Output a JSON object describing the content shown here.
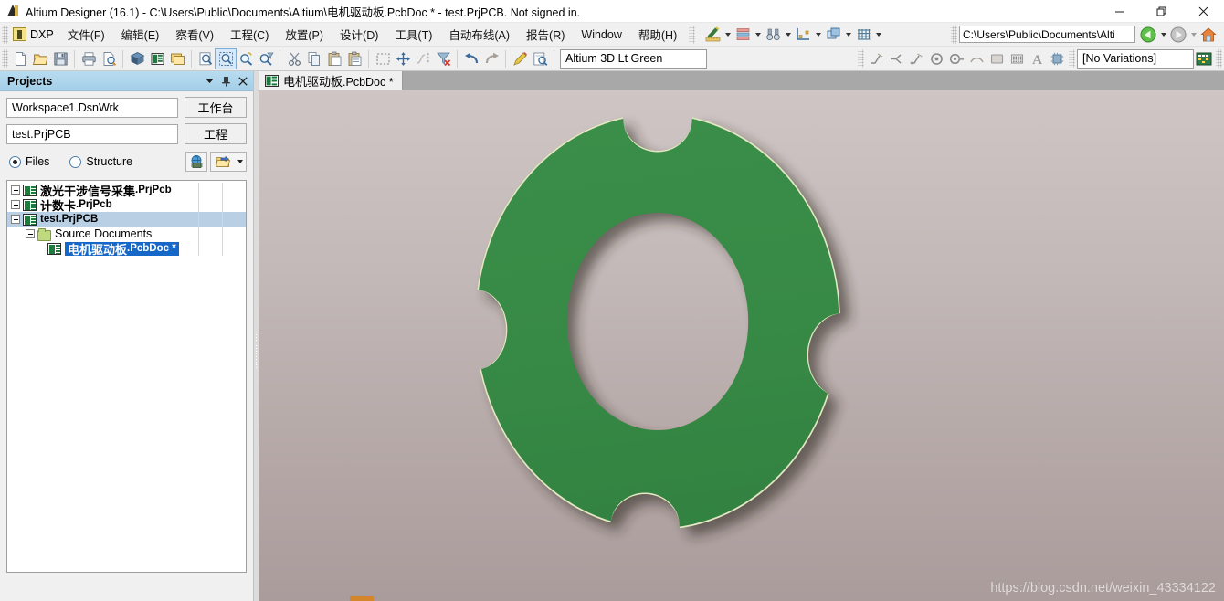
{
  "window": {
    "title": "Altium Designer (16.1) - C:\\Users\\Public\\Documents\\Altium\\电机驱动板.PcbDoc * - test.PrjPCB. Not signed in.",
    "app_icon": "altium-a-icon",
    "controls": {
      "minimize": "minimize-icon",
      "restore": "restore-icon",
      "close": "close-icon"
    }
  },
  "menubar": {
    "dxp_label": "DXP",
    "items": [
      {
        "label": "文件(F)",
        "mnemonic": "F"
      },
      {
        "label": "编辑(E)",
        "mnemonic": "E"
      },
      {
        "label": "察看(V)",
        "mnemonic": "V"
      },
      {
        "label": "工程(C)",
        "mnemonic": "C"
      },
      {
        "label": "放置(P)",
        "mnemonic": "P"
      },
      {
        "label": "设计(D)",
        "mnemonic": "D"
      },
      {
        "label": "工具(T)",
        "mnemonic": "T"
      },
      {
        "label": "自动布线(A)",
        "mnemonic": "A"
      },
      {
        "label": "报告(R)",
        "mnemonic": "R"
      },
      {
        "label": "Window",
        "mnemonic": "W"
      },
      {
        "label": "帮助(H)",
        "mnemonic": "H"
      }
    ],
    "quick_tools": [
      "ruler-pencil-icon",
      "layer-stack-icon",
      "binoculars-find-icon",
      "measure-dimension-icon",
      "layers-arrange-icon",
      "grid-icon"
    ],
    "path_value": "C:\\Users\\Public\\Documents\\Alti",
    "nav_back": "back-arrow-icon",
    "nav_forward": "forward-arrow-icon",
    "nav_home": "home-icon"
  },
  "toolbar": {
    "left_icons": [
      "new-document-icon",
      "open-folder-icon",
      "save-icon",
      "print-icon",
      "print-preview-icon",
      "board-3d-icon",
      "pcb-document-icon",
      "panels-icon",
      "zoom-document-icon",
      "zoom-area-icon",
      "zoom-in-icon",
      "zoom-filter-icon",
      "cut-icon",
      "copy-icon",
      "paste-icon",
      "paste-special-icon",
      "select-area-icon",
      "move-icon",
      "cross-probe-icon",
      "clear-filter-icon",
      "undo-icon",
      "redo-icon",
      "highlight-wand-icon",
      "inspect-icon"
    ],
    "view_config_value": "Altium 3D Lt Green",
    "right_icons": [
      "place-track-icon",
      "place-line-icon",
      "place-interactive-route-icon",
      "place-via-icon",
      "place-pad-icon",
      "place-arc-icon",
      "place-fill-icon",
      "place-polygon-icon",
      "place-string-icon",
      "place-component-icon"
    ],
    "variations_value": "[No Variations]",
    "variations_icon": "variant-table-icon"
  },
  "panel": {
    "title": "Projects",
    "header_buttons": {
      "dropdown": "chevron-down-icon",
      "pin": "pin-icon",
      "close": "close-icon"
    },
    "workspace_value": "Workspace1.DsnWrk",
    "workspace_button": "工作台",
    "project_value": "test.PrjPCB",
    "project_button": "工程",
    "view_mode": {
      "files_label": "Files",
      "structure_label": "Structure",
      "selected": "Files"
    },
    "tool_buttons": [
      "globe-chip-icon",
      "open-project-icon",
      "dropdown-arrow-icon"
    ],
    "tree": [
      {
        "name_cn": "激光干涉信号采集",
        "name_ext": ".PrjPcb",
        "indent": 0,
        "expander": "plus",
        "icon": "pcb-project-icon",
        "selected": "none"
      },
      {
        "name_cn": "计数卡",
        "name_ext": ".PrjPcb",
        "indent": 0,
        "expander": "plus",
        "icon": "pcb-project-icon",
        "selected": "none"
      },
      {
        "name_cn": "",
        "name_ext": "test.PrjPCB",
        "indent": 0,
        "expander": "minus",
        "icon": "pcb-project-icon",
        "selected": "gray"
      },
      {
        "name_cn": "",
        "name_ext": "Source Documents",
        "indent": 1,
        "expander": "minus",
        "icon": "folder-icon",
        "selected": "none"
      },
      {
        "name_cn": "电机驱动板",
        "name_ext": ".PcbDoc *",
        "indent": 2,
        "expander": "none",
        "icon": "pcb-document-icon",
        "selected": "blue"
      }
    ]
  },
  "document": {
    "tab_label_cn": "电机驱动板",
    "tab_label_ext": ".PcbDoc *",
    "tab_icon": "pcb-document-icon"
  },
  "viewport": {
    "watermark": "https://blog.csdn.net/weixin_43334122",
    "board": {
      "shape": "annular-pcb-with-four-notches",
      "fill_color": "#378a45",
      "edge_highlight": "#e8e8c8",
      "shadow_color": "#3a3230",
      "notch_count": 4,
      "background_top": "#cec5c4",
      "background_bottom": "#a99c9b"
    },
    "connector": {
      "color": "#d3862c",
      "name": "board-connector"
    }
  }
}
